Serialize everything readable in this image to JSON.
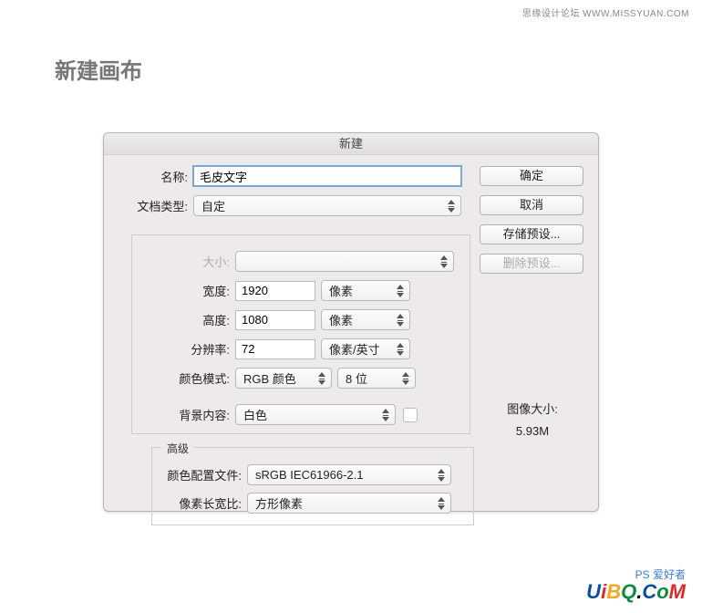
{
  "page": {
    "top_text": "思缘设计论坛  WWW.MISSYUAN.COM",
    "title": "新建画布",
    "footer_sub": "PS 爱好者"
  },
  "dialog": {
    "title": "新建",
    "name_label": "名称:",
    "name_value": "毛皮文字",
    "doc_type_label": "文档类型:",
    "doc_type_value": "自定",
    "size_label": "大小:",
    "size_value": "",
    "width_label": "宽度:",
    "width_value": "1920",
    "width_unit": "像素",
    "height_label": "高度:",
    "height_value": "1080",
    "height_unit": "像素",
    "resolution_label": "分辨率:",
    "resolution_value": "72",
    "resolution_unit": "像素/英寸",
    "color_mode_label": "颜色模式:",
    "color_mode_value": "RGB 颜色",
    "color_depth_value": "8 位",
    "bg_label": "背景内容:",
    "bg_value": "白色",
    "advanced_label": "高级",
    "color_profile_label": "颜色配置文件:",
    "color_profile_value": "sRGB IEC61966-2.1",
    "pixel_aspect_label": "像素长宽比:",
    "pixel_aspect_value": "方形像素",
    "image_size_label": "图像大小:",
    "image_size_value": "5.93M"
  },
  "buttons": {
    "ok": "确定",
    "cancel": "取消",
    "save_preset": "存储预设...",
    "delete_preset": "删除预设..."
  }
}
